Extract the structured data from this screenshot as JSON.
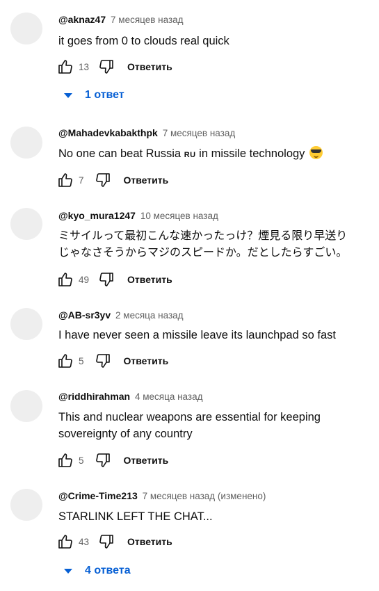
{
  "comments": [
    {
      "author": "@aknaz47",
      "time": "7 месяцев назад",
      "text": "it goes from 0 to clouds real quick",
      "likes": "13",
      "reply_label": "Ответить",
      "replies_label": "1 ответ"
    },
    {
      "author": "@Mahadevkabakthpk",
      "time": "7 месяцев назад",
      "text_before": "No one can beat Russia ",
      "flag": "RU",
      "text_after": " in missile technology ",
      "emoji_icon": "smiling-face-with-sunglasses-icon",
      "likes": "7",
      "reply_label": "Ответить"
    },
    {
      "author": "@kyo_mura1247",
      "time": "10 месяцев назад",
      "text_line1": "ミサイルって最初こんな速かったっけ？煙見る限り早送り",
      "text_line2": "じゃなさそうからマジのスピードか。だとしたらすごい。",
      "likes": "49",
      "reply_label": "Ответить"
    },
    {
      "author": "@AB-sr3yv",
      "time": "2 месяца назад",
      "text": "I have never seen a missile leave its launchpad so fast",
      "likes": "5",
      "reply_label": "Ответить"
    },
    {
      "author": "@riddhirahman",
      "time": "4 месяца назад",
      "text_line1": "This and nuclear weapons are essential for keeping",
      "text_line2": "sovereignty of any country",
      "likes": "5",
      "reply_label": "Ответить"
    },
    {
      "author": "@Crime-Time213",
      "time": "7 месяцев назад (изменено)",
      "text": "STARLINK LEFT THE CHAT...",
      "likes": "43",
      "reply_label": "Ответить",
      "replies_label": "4 ответа"
    }
  ],
  "icons": {
    "like": "thumb-up-icon",
    "dislike": "thumb-down-icon",
    "expand": "chevron-down-icon"
  },
  "colors": {
    "link_blue": "#065fd4",
    "secondary_text": "#606060",
    "avatar_placeholder": "#eeeeee"
  }
}
